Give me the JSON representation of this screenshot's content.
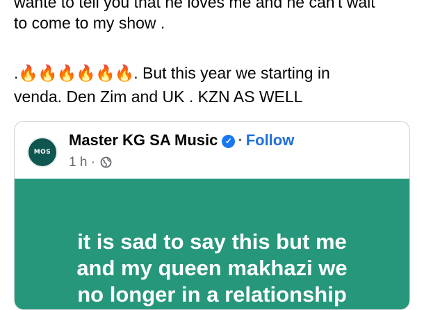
{
  "post": {
    "line_top": "wante to tell you that he loves me and he can't wait",
    "line_show": "to come to my show .",
    "flames_prefix": ".",
    "flames": "🔥🔥🔥🔥🔥🔥",
    "line_venda_rest": ". But this year we starting in",
    "line_venda_2": "venda. Den Zim and UK . KZN AS WELL"
  },
  "shared": {
    "avatar_text": "MOS",
    "page_name": "Master KG SA Music",
    "separator": "·",
    "follow_label": "Follow",
    "time": "1 h",
    "meta_separator": "·",
    "story_lines": [
      "it is sad to say this but me",
      "and my queen makhazi we",
      "no longer in a relationship"
    ],
    "story_bg": "#27977b",
    "follow_color": "#216fdb",
    "verified_color": "#1877f2"
  }
}
